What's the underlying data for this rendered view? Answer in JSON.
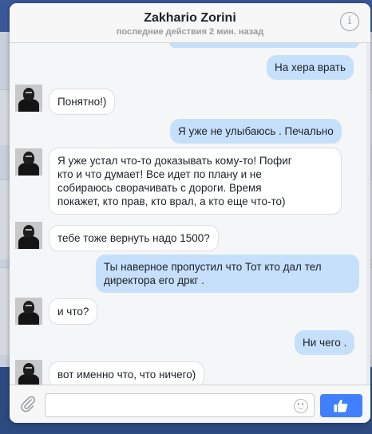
{
  "header": {
    "title": "Zakhario Zorini",
    "status": "последние действия 2 мин. назад",
    "info_icon": "info-icon"
  },
  "messages": [
    {
      "from": "me",
      "text": "На хера врать"
    },
    {
      "from": "contact",
      "text": "Понятно!)"
    },
    {
      "from": "me",
      "text": "Я уже не улыбаюсь . Печально"
    },
    {
      "from": "contact",
      "text": "Я уже устал что-то доказывать кому-то! Пофиг\nкто и что думает! Все идет по плану  и не\nсобираюсь сворачивать с дороги. Время\nпокажет, кто прав, кто врал, а кто еще что-то)"
    },
    {
      "from": "contact",
      "text": "тебе тоже вернуть надо 1500?"
    },
    {
      "from": "me",
      "text": "Ты наверное пропустил что Тот кто дал тел\nдиректора его дркг ."
    },
    {
      "from": "contact",
      "text": "и что?"
    },
    {
      "from": "me",
      "text": "Ни чего ."
    },
    {
      "from": "contact",
      "text": "вот именно что, что ничего)"
    }
  ],
  "composer": {
    "input_value": "",
    "input_placeholder": "",
    "attach_icon": "paperclip-icon",
    "emoji_icon": "smiley-icon",
    "like_icon": "thumbs-up-icon"
  },
  "colors": {
    "outgoing_bubble": "#c6e0fb",
    "incoming_bubble": "#ffffff",
    "like_button": "#4080ff",
    "background": "#3b5998"
  }
}
